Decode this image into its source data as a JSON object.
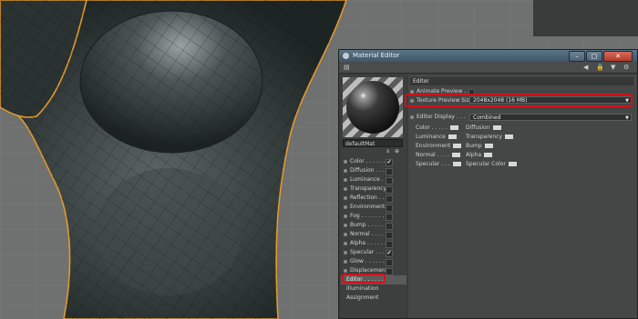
{
  "window": {
    "title": "Material Editor"
  },
  "window_buttons": [
    {
      "icon": "minimize-icon",
      "glyph": "–"
    },
    {
      "icon": "maximize-icon",
      "glyph": "□"
    },
    {
      "icon": "close-icon",
      "glyph": "✕"
    }
  ],
  "toolbar_icons": [
    {
      "icon": "grip-icon",
      "glyph": "▤"
    },
    {
      "icon": "back-arrow-icon",
      "glyph": "◀"
    },
    {
      "icon": "lock-icon",
      "glyph": "🔒"
    },
    {
      "icon": "filter-icon",
      "glyph": "▼"
    }
  ],
  "material": {
    "name": "defaultMat",
    "controls": [
      "s",
      "⊕"
    ]
  },
  "channels": [
    {
      "label": "Color . . . . . . .",
      "checked": true
    },
    {
      "label": "Diffusion . . . . .",
      "checked": false
    },
    {
      "label": "Luminance . . . .",
      "checked": false
    },
    {
      "label": "Transparency",
      "checked": false
    },
    {
      "label": "Reflection . . . .",
      "checked": false
    },
    {
      "label": "Environment",
      "checked": false
    },
    {
      "label": "Fog . . . . . . . .",
      "checked": false
    },
    {
      "label": "Bump . . . . . . .",
      "checked": false
    },
    {
      "label": "Normal . . . . . .",
      "checked": false
    },
    {
      "label": "Alpha . . . . . . .",
      "checked": false
    },
    {
      "label": "Specular . . . .",
      "checked": true
    },
    {
      "label": "Glow . . . . . . .",
      "checked": false
    },
    {
      "label": "Displacement",
      "checked": false
    }
  ],
  "extra_items": [
    "Editor . . . . . .",
    "Illumination",
    "Assignment"
  ],
  "editor_section": {
    "title": "Editor",
    "animate_preview": {
      "label": "Animate Preview . ."
    },
    "texture_preview_size": {
      "label": "Texture Preview Size",
      "value": "2048x2048 (16 MB)"
    },
    "editor_display": {
      "label": "Editor Display . . .",
      "value": "Combined"
    },
    "grid_col1": [
      "Color . . . . .",
      "Luminance",
      "Environment",
      "Normal . . . .",
      "Specular . . ."
    ],
    "grid_col2": [
      "Diffusion",
      "Transparency",
      "Bump",
      "Alpha",
      "Specular Color"
    ]
  },
  "check_glyph": "✔",
  "colors": {
    "highlight": "#d1121b",
    "titlebar": "#4b6578",
    "panel": "#454646",
    "viewport_bg": "#6f7070",
    "model": "#2c3434",
    "outline": "#e39a2a"
  }
}
